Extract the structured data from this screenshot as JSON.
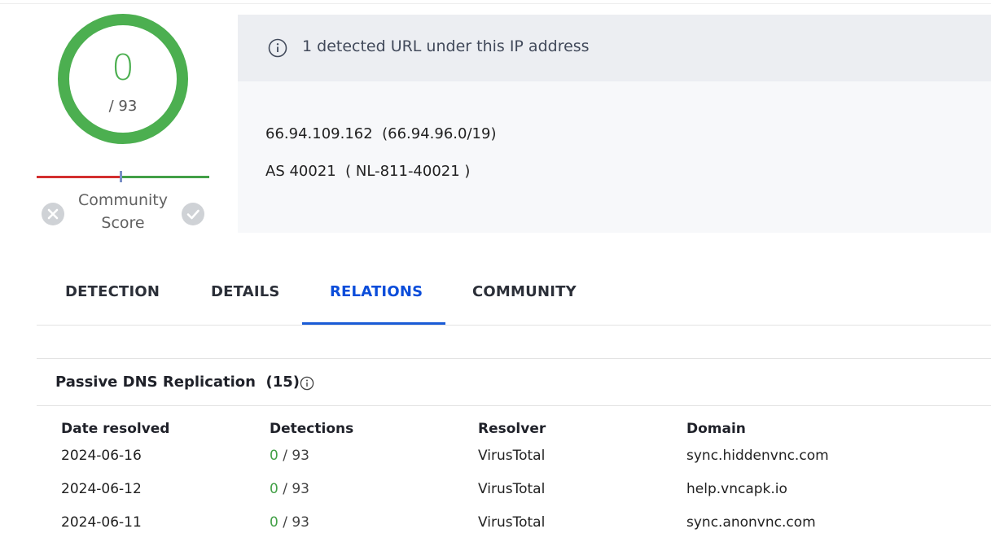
{
  "score": {
    "value": "0",
    "total": "/ 93",
    "community_label": "Community Score",
    "ring_color": "#4caf50"
  },
  "ip_card": {
    "title": "1 detected URL under this IP address",
    "ip_line": "66.94.109.162  (66.94.96.0/19)",
    "as_line": "AS 40021  ( NL-811-40021 )",
    "icon": "info-icon"
  },
  "tabs": [
    {
      "label": "DETECTION",
      "active": false
    },
    {
      "label": "DETAILS",
      "active": false
    },
    {
      "label": "RELATIONS",
      "active": true
    },
    {
      "label": "COMMUNITY",
      "active": false
    }
  ],
  "passive_dns": {
    "title": "Passive DNS Replication  (15)",
    "headers": [
      "Date resolved",
      "Detections",
      "Resolver",
      "Domain"
    ],
    "rows": [
      {
        "date": "2024-06-16",
        "detections": "0",
        "total": "/ 93",
        "resolver": "VirusTotal",
        "domain": "sync.hiddenvnc.com"
      },
      {
        "date": "2024-06-12",
        "detections": "0",
        "total": "/ 93",
        "resolver": "VirusTotal",
        "domain": "help.vncapk.io"
      },
      {
        "date": "2024-06-11",
        "detections": "0",
        "total": "/ 93",
        "resolver": "VirusTotal",
        "domain": "sync.anonvnc.com"
      }
    ]
  },
  "colors": {
    "accent": "#1a5bd6",
    "clean": "#43a047",
    "malicious": "#d32f2f"
  }
}
